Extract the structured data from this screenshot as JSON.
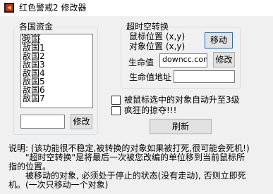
{
  "window": {
    "title": "红色警戒2 修改器"
  },
  "funds_group": {
    "legend": "各国资金",
    "list_items": [
      "我国",
      "敌国1",
      "敌国2",
      "敌国3",
      "敌国4",
      "敌国5",
      "敌国6",
      "敌国7"
    ],
    "selected_index": 0,
    "value_input": "",
    "modify_label": "修改"
  },
  "transform_group": {
    "legend": "超时空转换",
    "cursor_position_label": "鼠标位置 (x,y)",
    "object_position_label": "对象位置 (x,y)",
    "move_label": "移动",
    "hp_label": "生命值",
    "hp_value": "downcc.com",
    "modify_label": "修改",
    "hp_address_label": "生命值地址",
    "hp_address_value": ""
  },
  "options": {
    "auto_upgrade_label": "被鼠标选中的对象自动升至3级",
    "crazy_plunder_label": "疯狂的掠夺!!!",
    "auto_upgrade_checked": false,
    "crazy_plunder_checked": false
  },
  "refresh_label": "刷新",
  "description": [
    "说明: (该功能很不稳定,被转换的对象如果被打死,很可能会死机!)",
    "　　\"超时空转换\"是将最后一次被您改编的单位移到当前鼠标所",
    "指的位置。",
    "　　被移动的对象, 必须处于停止的状态(没有走动), 否则立即死",
    "机。(一次只移动一个对象)"
  ],
  "colors": {
    "accent": "#0078d7",
    "title_icon_red": "#d8241c"
  }
}
